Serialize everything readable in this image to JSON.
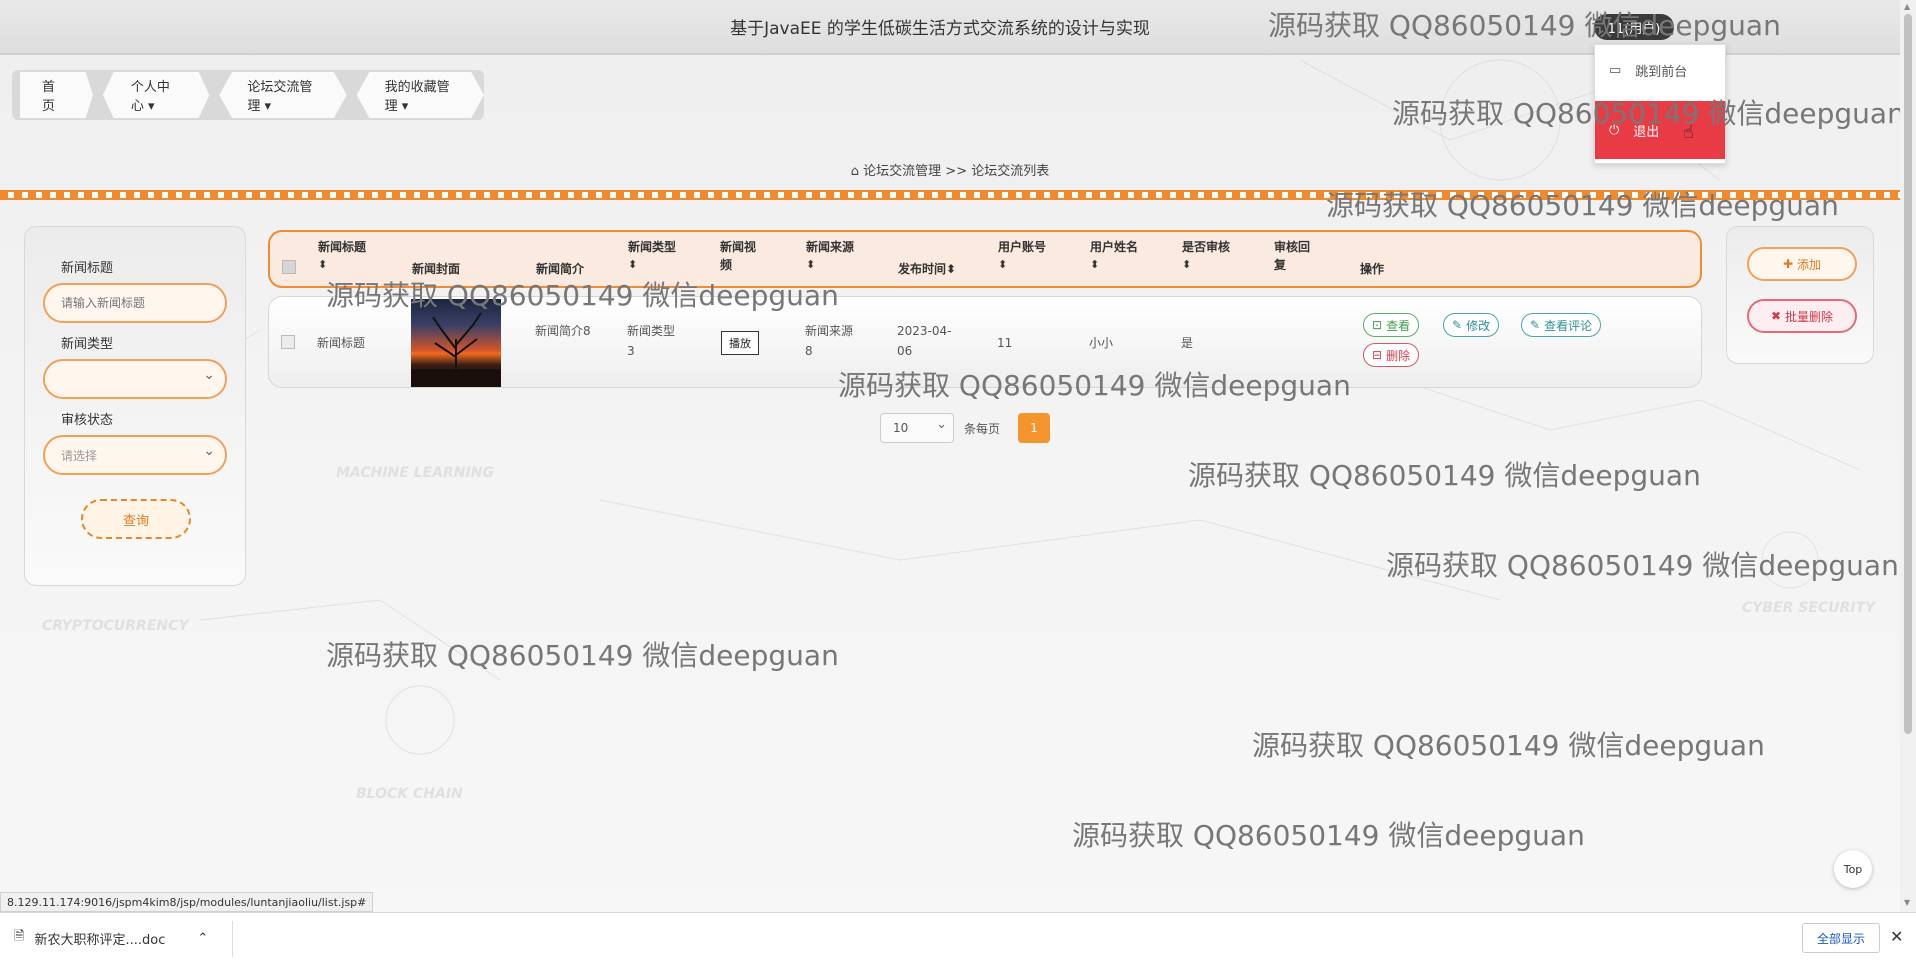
{
  "header": {
    "title": "基于JavaEE 的学生低碳生活方式交流系统的设计与实现",
    "user_badge": "11(用户)",
    "user_menu": {
      "front_label": "跳到前台",
      "logout_label": "退出"
    }
  },
  "nav": {
    "items": [
      {
        "label": "首页"
      },
      {
        "label": "个人中心 ▾"
      },
      {
        "label": "论坛交流管理 ▾"
      },
      {
        "label": "我的收藏管理 ▾"
      }
    ]
  },
  "breadcrumb": {
    "section": "论坛交流管理",
    "separator": ">>",
    "page": "论坛交流列表"
  },
  "search": {
    "title_label": "新闻标题",
    "title_placeholder": "请输入新闻标题",
    "type_label": "新闻类型",
    "type_value": "",
    "review_label": "审核状态",
    "review_placeholder": "请选择",
    "query_button": "查询"
  },
  "table": {
    "headers": [
      "新闻标题",
      "新闻封面",
      "新闻简介",
      "新闻类型",
      "新闻视频",
      "新闻来源",
      "发布时间",
      "用户账号",
      "用户姓名",
      "是否审核",
      "审核回复",
      "操作"
    ],
    "sort_glyph": "⬍",
    "rows": [
      {
        "title": "新闻标题",
        "intro": "新闻简介8",
        "type": "新闻类型3",
        "video_button": "播放",
        "source": "新闻来源8",
        "publish_time": "2023-04-06",
        "account": "11",
        "name": "小小",
        "reviewed": "是",
        "reply": ""
      }
    ],
    "actions": {
      "view": "查看",
      "edit": "修改",
      "comments": "查看评论",
      "delete": "删除"
    }
  },
  "pagination": {
    "page_size": "10",
    "per_page_label": "条每页",
    "current_page": "1"
  },
  "actions": {
    "add_label": "添加",
    "batch_delete_label": "批量删除"
  },
  "watermark": "源码获取 QQ86050149 微信deepguan",
  "top_button": "Top",
  "status_url": "8.129.11.174:9016/jspm4kim8/jsp/modules/luntanjiaoliu/list.jsp#",
  "download_bar": {
    "file_name": "新农大职称评定....doc",
    "show_all": "全部显示"
  },
  "colors": {
    "accent": "#f08a2c",
    "logout": "#e93b45",
    "delete": "#d5394c"
  }
}
